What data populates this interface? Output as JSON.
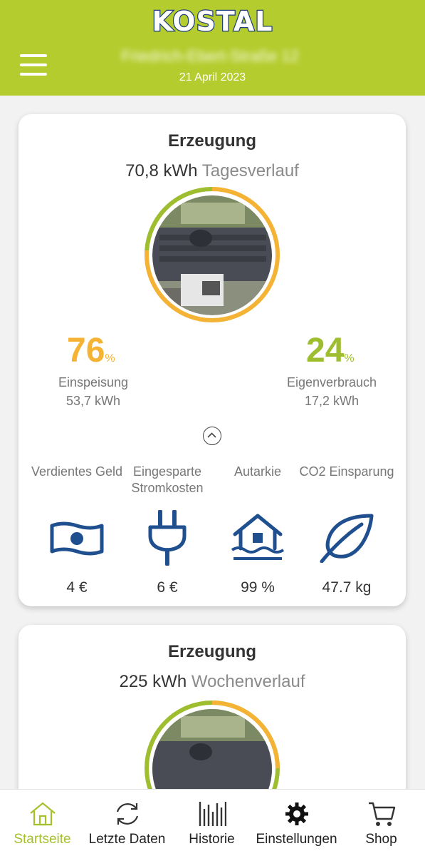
{
  "header": {
    "brand": "KOSTAL",
    "location": "Friedrich-Ebert-Straße 12",
    "date": "21 April 2023",
    "colors": {
      "background": "#b5cc2e",
      "logo": "#1f3f7a"
    }
  },
  "daily": {
    "title": "Erzeugung",
    "total": "70,8 kWh",
    "period_label": "Tagesverlauf",
    "feed_in": {
      "percent": "76",
      "unit": "%",
      "label": "Einspeisung",
      "energy": "53,7 kWh",
      "fraction": 0.76
    },
    "self_use": {
      "percent": "24",
      "unit": "%",
      "label": "Eigenverbrauch",
      "energy": "17,2 kWh",
      "fraction": 0.24
    },
    "stats": [
      {
        "label": "Verdientes Geld",
        "icon": "banknote-icon",
        "value": "4 €"
      },
      {
        "label": "Eingesparte Stromkosten",
        "icon": "plug-icon",
        "value": "6 €"
      },
      {
        "label": "Autarkie",
        "icon": "house-water-icon",
        "value": "99 %"
      },
      {
        "label": "CO2 Einsparung",
        "icon": "leaf-icon",
        "value": "47.7 kg"
      }
    ]
  },
  "weekly": {
    "title": "Erzeugung",
    "total": "225 kWh",
    "period_label": "Wochenverlauf"
  },
  "nav": {
    "items": [
      {
        "label": "Startseite",
        "icon": "home-icon",
        "active": true
      },
      {
        "label": "Letzte Daten",
        "icon": "refresh-icon",
        "active": false
      },
      {
        "label": "Historie",
        "icon": "bar-chart-icon",
        "active": false
      },
      {
        "label": "Einstellungen",
        "icon": "gear-icon",
        "active": false
      },
      {
        "label": "Shop",
        "icon": "cart-icon",
        "active": false
      }
    ]
  },
  "colors": {
    "feed_in": "#f5b335",
    "self_use": "#9ebd2f",
    "icon_blue": "#1f4f8f",
    "active_nav": "#a4c02c"
  }
}
